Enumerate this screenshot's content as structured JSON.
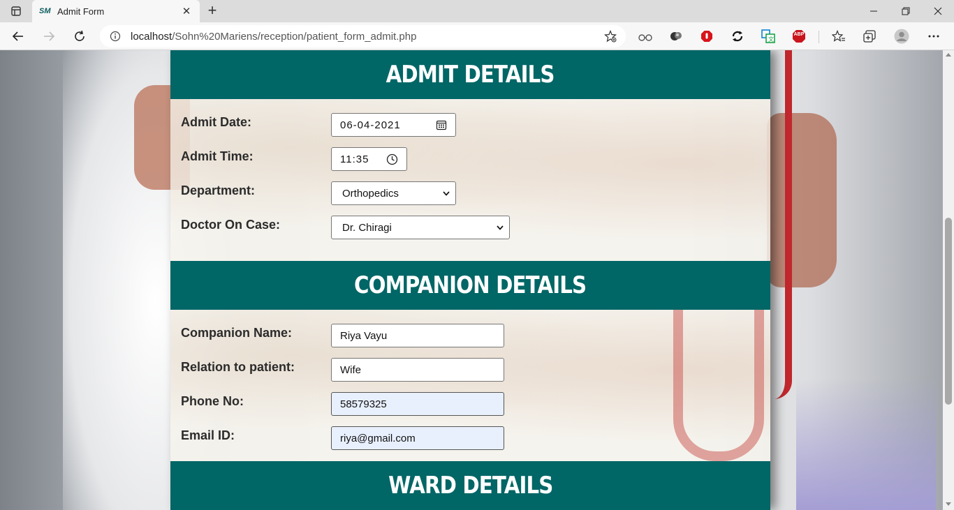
{
  "browser": {
    "tab": {
      "favicon": "SM",
      "title": "Admit Form",
      "close_icon": "close-icon"
    },
    "new_tab_icon": "plus-icon",
    "url": {
      "host": "localhost",
      "path": "/Sohn%20Mariens/reception/patient_form_admit.php"
    },
    "extensions": [
      "favorite-add-icon",
      "read-aloud-icon",
      "extension-icon",
      "adblock-red-icon",
      "sync-icon",
      "translate-icon",
      "abp-icon",
      "favorites-icon",
      "collections-icon",
      "profile-avatar",
      "more-icon"
    ],
    "abp_label": "ABP"
  },
  "sections": {
    "admit": {
      "title": "ADMIT DETAILS",
      "fields": {
        "admit_date": {
          "label": "Admit Date:",
          "value": "06-04-2021"
        },
        "admit_time": {
          "label": "Admit Time:",
          "value": "11:35"
        },
        "department": {
          "label": "Department:",
          "value": "Orthopedics"
        },
        "doctor": {
          "label": "Doctor On Case:",
          "value": "Dr. Chiragi"
        }
      }
    },
    "companion": {
      "title": "COMPANION DETAILS",
      "fields": {
        "name": {
          "label": "Companion Name:",
          "value": "Riya Vayu"
        },
        "relation": {
          "label": "Relation to patient:",
          "value": "Wife"
        },
        "phone": {
          "label": "Phone No:",
          "value": "58579325"
        },
        "email": {
          "label": "Email ID:",
          "value": "riya@gmail.com"
        }
      }
    },
    "ward": {
      "title": "WARD DETAILS"
    }
  },
  "colors": {
    "section_header": "#006666",
    "autofill": "#e8f0fe"
  }
}
